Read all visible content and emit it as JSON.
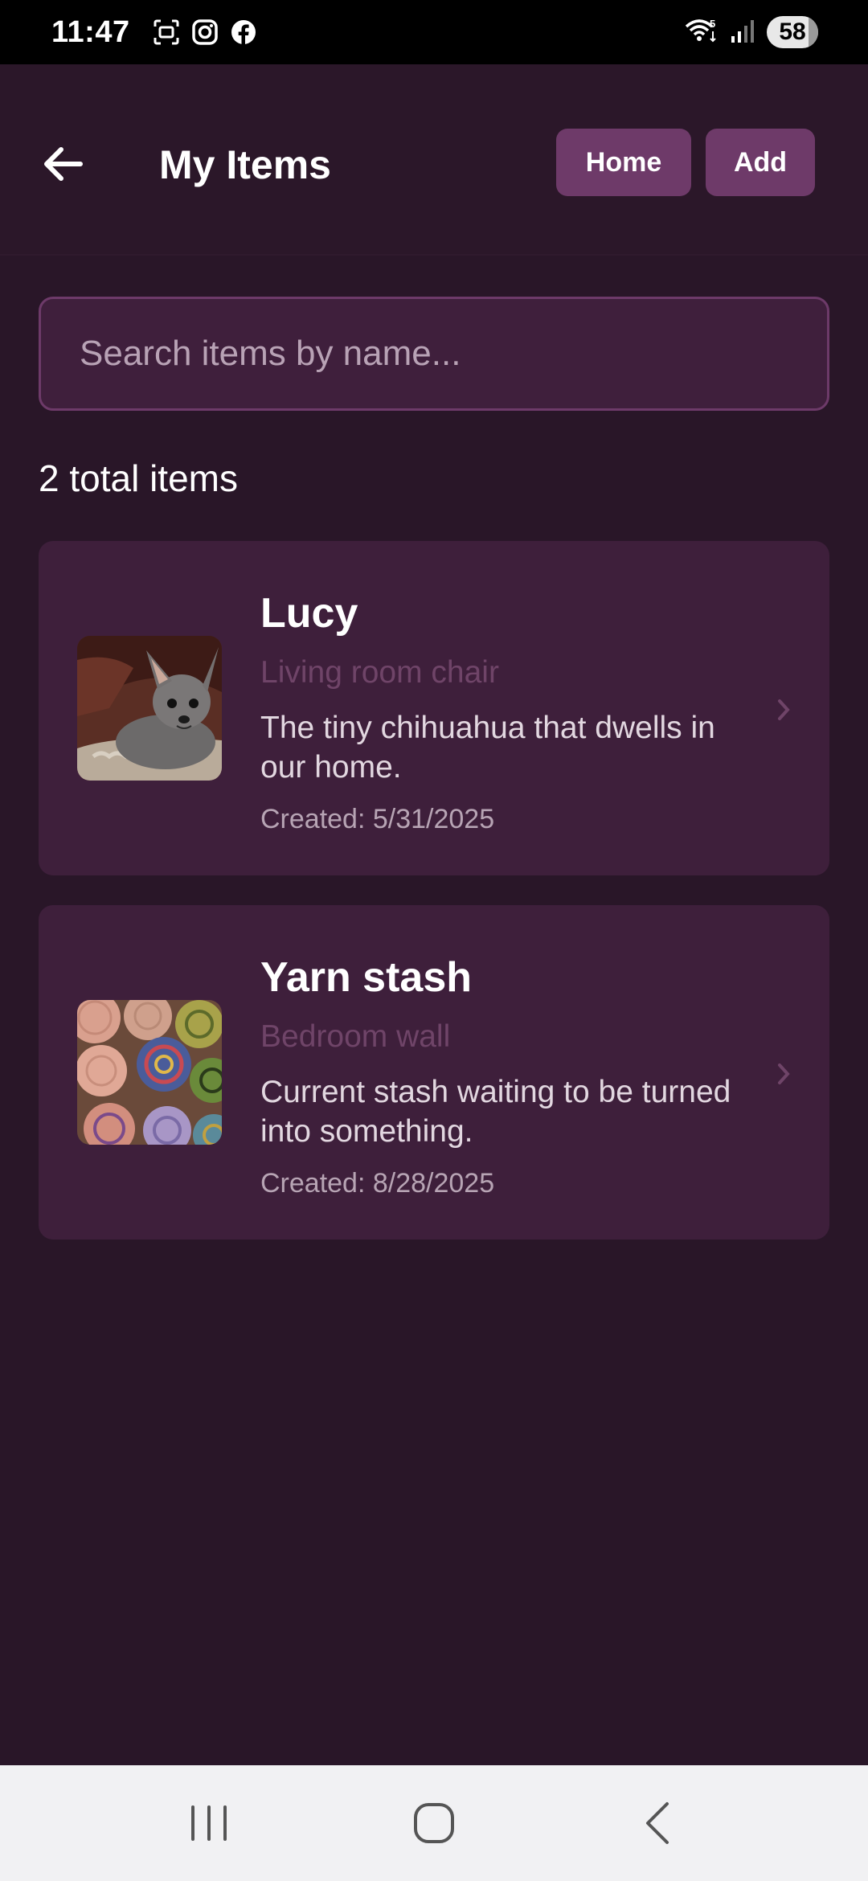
{
  "status_bar": {
    "time": "11:47",
    "left_icons": [
      "screenshot-icon",
      "instagram-icon",
      "facebook-icon"
    ],
    "right_icons": [
      "wifi-icon",
      "signal-icon"
    ],
    "battery": "58"
  },
  "header": {
    "title": "My Items",
    "back_icon": "arrow-left-icon",
    "home_label": "Home",
    "add_label": "Add"
  },
  "search": {
    "placeholder": "Search items by name...",
    "value": ""
  },
  "summary": {
    "total_label": "2 total items"
  },
  "items": [
    {
      "title": "Lucy",
      "location": "Living room chair",
      "description": "The tiny chihuahua that dwells in our home.",
      "created": "Created: 5/31/2025",
      "thumbnail": "chihuahua-photo"
    },
    {
      "title": "Yarn stash",
      "location": "Bedroom wall",
      "description": "Current stash waiting to be turned into something.",
      "created": "Created: 8/28/2025",
      "thumbnail": "yarn-photo"
    }
  ],
  "nav": {
    "icons": [
      "recent-apps-icon",
      "home-circle-icon",
      "back-chevron-icon"
    ]
  },
  "colors": {
    "background": "#291628",
    "card": "#3e1f3b",
    "accent_button": "#6e3a69",
    "location_text": "#6f4468"
  }
}
